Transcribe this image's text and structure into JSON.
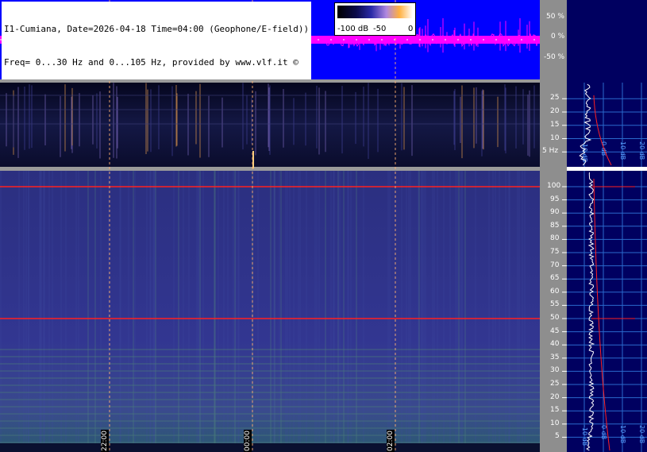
{
  "header": {
    "line1": "I1-Cumiana, Date=2026-04-18 Time=04:00 (Geophone/E-field))",
    "line2": "Freq= 0...30 Hz and 0...105 Hz, provided by www.vlf.it ©"
  },
  "colorbar": {
    "labels": [
      "-100 dB",
      "-50",
      "0"
    ]
  },
  "amplitude_axis": {
    "ticks": [
      "50 %",
      "0 %",
      "-50 %"
    ]
  },
  "low_freq_axis": {
    "ticks": [
      "25",
      "20",
      "15",
      "10",
      "5 Hz"
    ],
    "values": [
      25,
      20,
      15,
      10,
      5
    ]
  },
  "high_freq_axis": {
    "ticks": [
      "100",
      "95",
      "90",
      "85",
      "80",
      "75",
      "70",
      "65",
      "60",
      "55",
      "50",
      "45",
      "40",
      "35",
      "30",
      "25",
      "20",
      "15",
      "10",
      "5"
    ],
    "values": [
      100,
      95,
      90,
      85,
      80,
      75,
      70,
      65,
      60,
      55,
      50,
      45,
      40,
      35,
      30,
      25,
      20,
      15,
      10,
      5
    ]
  },
  "time_markers": [
    "22:00",
    "00:00",
    "02:00"
  ],
  "spectrum_axis_upper": [
    "-10 dB",
    "0 dB",
    "10 dB",
    "20 dB"
  ],
  "spectrum_axis_lower": [
    "-10 dB",
    "0 dB",
    "10 dB",
    "20 dB"
  ],
  "colors": {
    "amplitude_bg": "#0000ff",
    "amplitude_trace": "#ff00ff",
    "spectrogram_bg": "#2a2e7a",
    "hum_line": "#ff2020",
    "marker_line": "#ffb070",
    "side_panel": "#000060"
  }
}
